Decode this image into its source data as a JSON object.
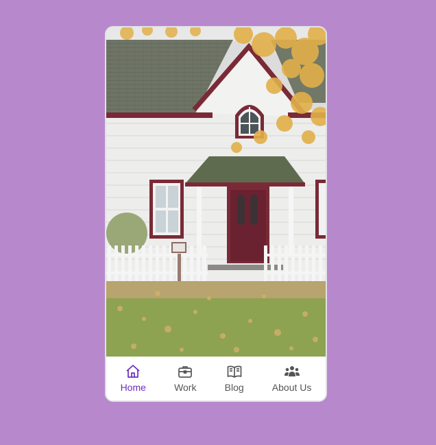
{
  "image": {
    "alt": ""
  },
  "navbar": {
    "items": [
      {
        "label": "Home",
        "icon": "home-icon",
        "active": true
      },
      {
        "label": "Work",
        "icon": "briefcase-icon",
        "active": false
      },
      {
        "label": "Blog",
        "icon": "book-icon",
        "active": false
      },
      {
        "label": "About Us",
        "icon": "people-icon",
        "active": false
      }
    ]
  },
  "colors": {
    "background": "#b888cc",
    "active": "#6c2bc0",
    "inactive": "#555555"
  }
}
